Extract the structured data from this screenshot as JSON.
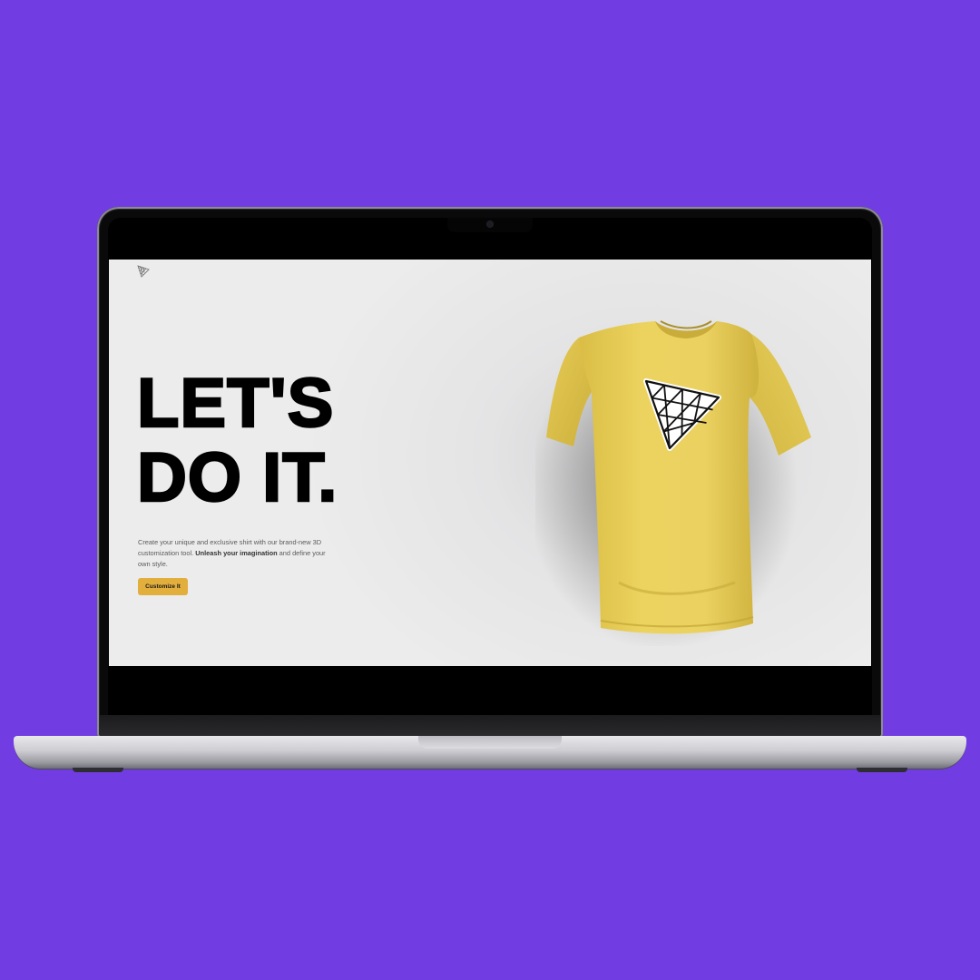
{
  "colors": {
    "background": "#713de2",
    "shirt": "#ecd35f",
    "button": "#e2ae3c",
    "screen_bg": "#e8e8e9",
    "headline": "#000000"
  },
  "page": {
    "logo_icon": "triangle-mesh-icon",
    "headline_line1": "LET'S",
    "headline_line2": "DO IT.",
    "description_part1": "Create your unique and exclusive shirt with our brand-new 3D customization tool. ",
    "description_bold": "Unleash your imagination",
    "description_part2": " and define your own style.",
    "cta_label": "Customize It"
  },
  "product": {
    "type": "t-shirt",
    "decal_icon": "triangle-mesh-icon"
  }
}
